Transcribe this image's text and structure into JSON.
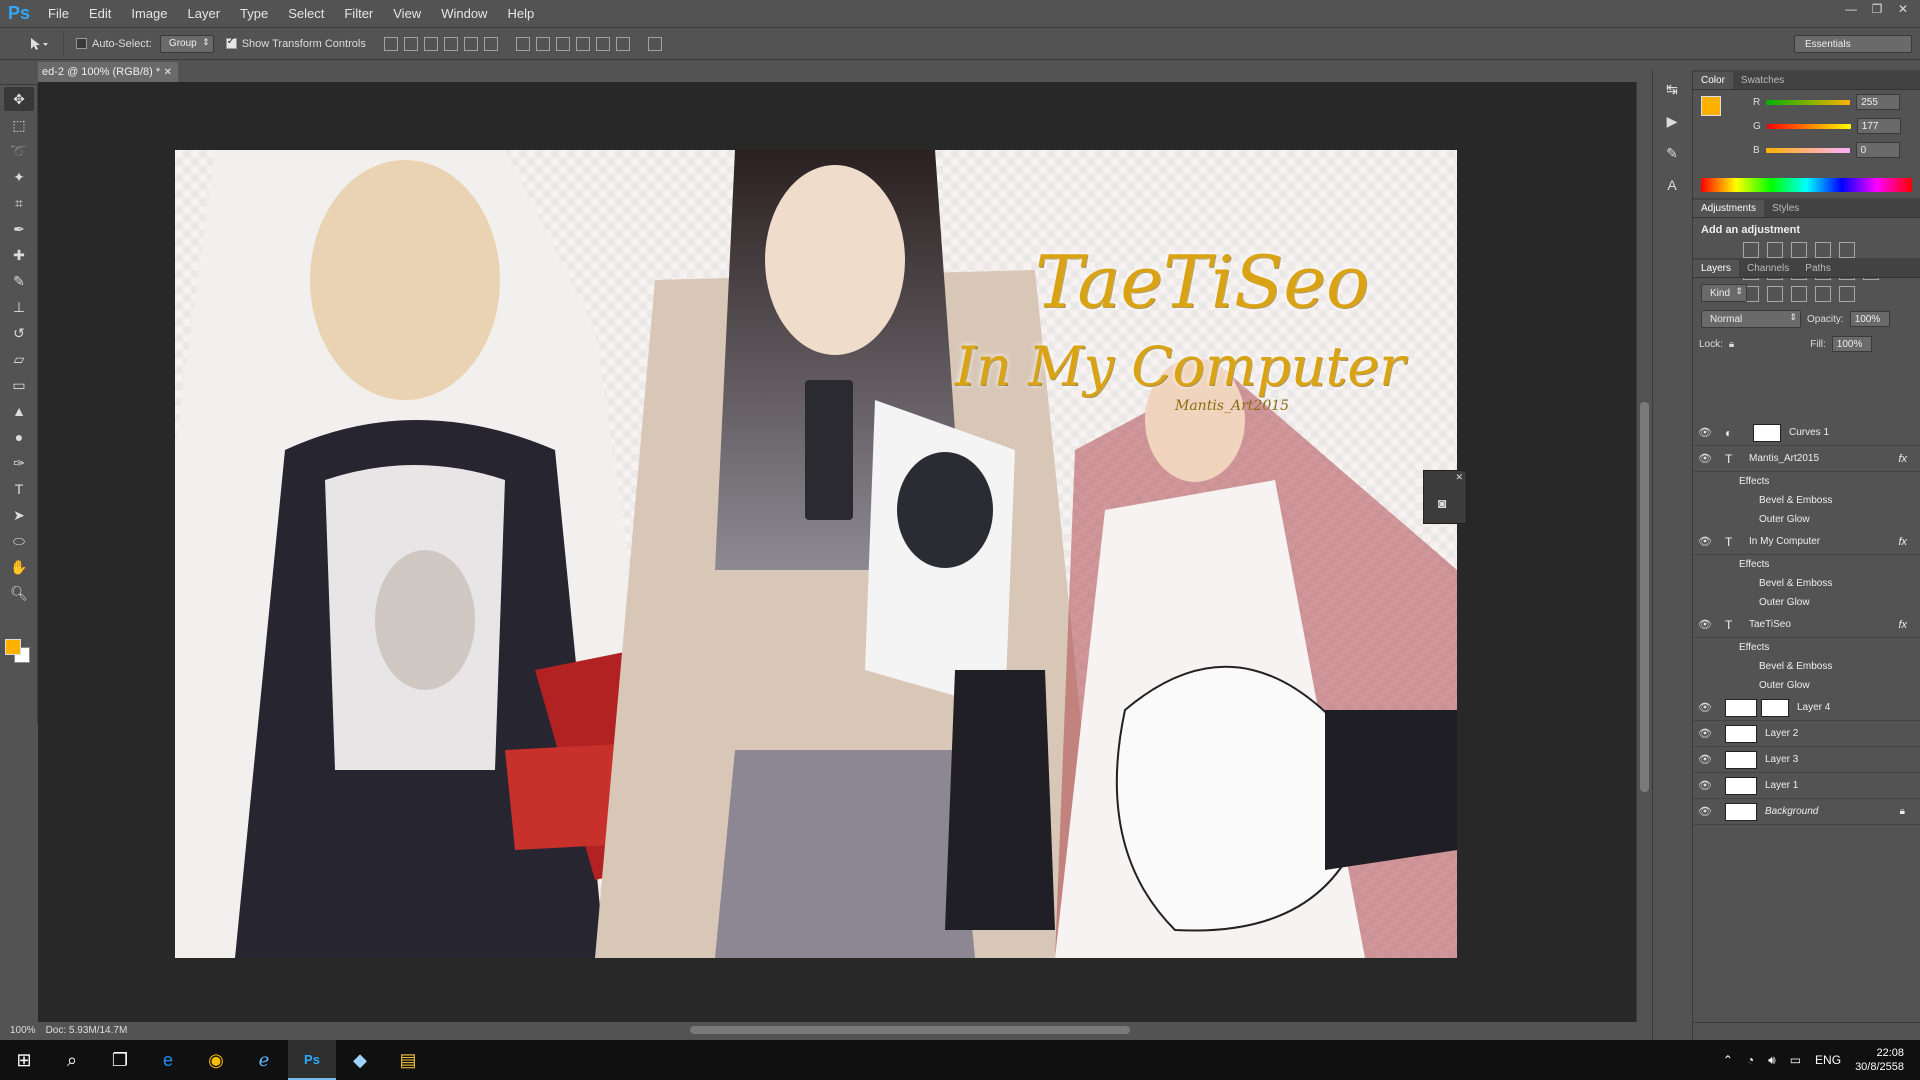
{
  "app": {
    "logo": "Ps"
  },
  "menu": [
    "File",
    "Edit",
    "Image",
    "Layer",
    "Type",
    "Select",
    "Filter",
    "View",
    "Window",
    "Help"
  ],
  "options": {
    "auto_select_label": "Auto-Select:",
    "auto_select_value": "Group",
    "show_transform_label": "Show Transform Controls",
    "workspace": "Essentials"
  },
  "document": {
    "tab_title": "ed-2 @ 100% (RGB/8) *"
  },
  "artwork": {
    "title_line1": "TaeTiSeo",
    "title_line2": "In My Computer",
    "signature": "Mantis_Art2015"
  },
  "status": {
    "zoom": "100%",
    "doc": "Doc: 5.93M/14.7M"
  },
  "color_panel": {
    "tabs": [
      "Color",
      "Swatches"
    ],
    "r_label": "R",
    "r": "255",
    "g_label": "G",
    "g": "177",
    "b_label": "B",
    "b": "0",
    "fg_color": "#ffb100"
  },
  "adjustments": {
    "tabs": [
      "Adjustments",
      "Styles"
    ],
    "title": "Add an adjustment"
  },
  "layers_panel": {
    "tabs": [
      "Layers",
      "Channels",
      "Paths"
    ],
    "kind": "Kind",
    "blend_mode": "Normal",
    "opacity_label": "Opacity:",
    "opacity": "100%",
    "lock_label": "Lock:",
    "fill_label": "Fill:",
    "fill": "100%",
    "layers": [
      {
        "name": "Curves 1",
        "type": "adjustment"
      },
      {
        "name": "Mantis_Art2015",
        "type": "text",
        "fx": "fx",
        "effects_label": "Effects",
        "effects": [
          "Bevel & Emboss",
          "Outer Glow"
        ]
      },
      {
        "name": "In My Computer",
        "type": "text",
        "fx": "fx",
        "effects_label": "Effects",
        "effects": [
          "Bevel & Emboss",
          "Outer Glow"
        ]
      },
      {
        "name": "TaeTiSeo",
        "type": "text",
        "fx": "fx",
        "effects_label": "Effects",
        "effects": [
          "Bevel & Emboss",
          "Outer Glow"
        ]
      },
      {
        "name": "Layer 4",
        "type": "pixel"
      },
      {
        "name": "Layer 2",
        "type": "pixel"
      },
      {
        "name": "Layer 3",
        "type": "pixel"
      },
      {
        "name": "Layer 1",
        "type": "pixel"
      },
      {
        "name": "Background",
        "type": "background"
      }
    ]
  },
  "taskbar": {
    "lang": "ENG",
    "time": "22:08",
    "date": "30/8/2558"
  }
}
